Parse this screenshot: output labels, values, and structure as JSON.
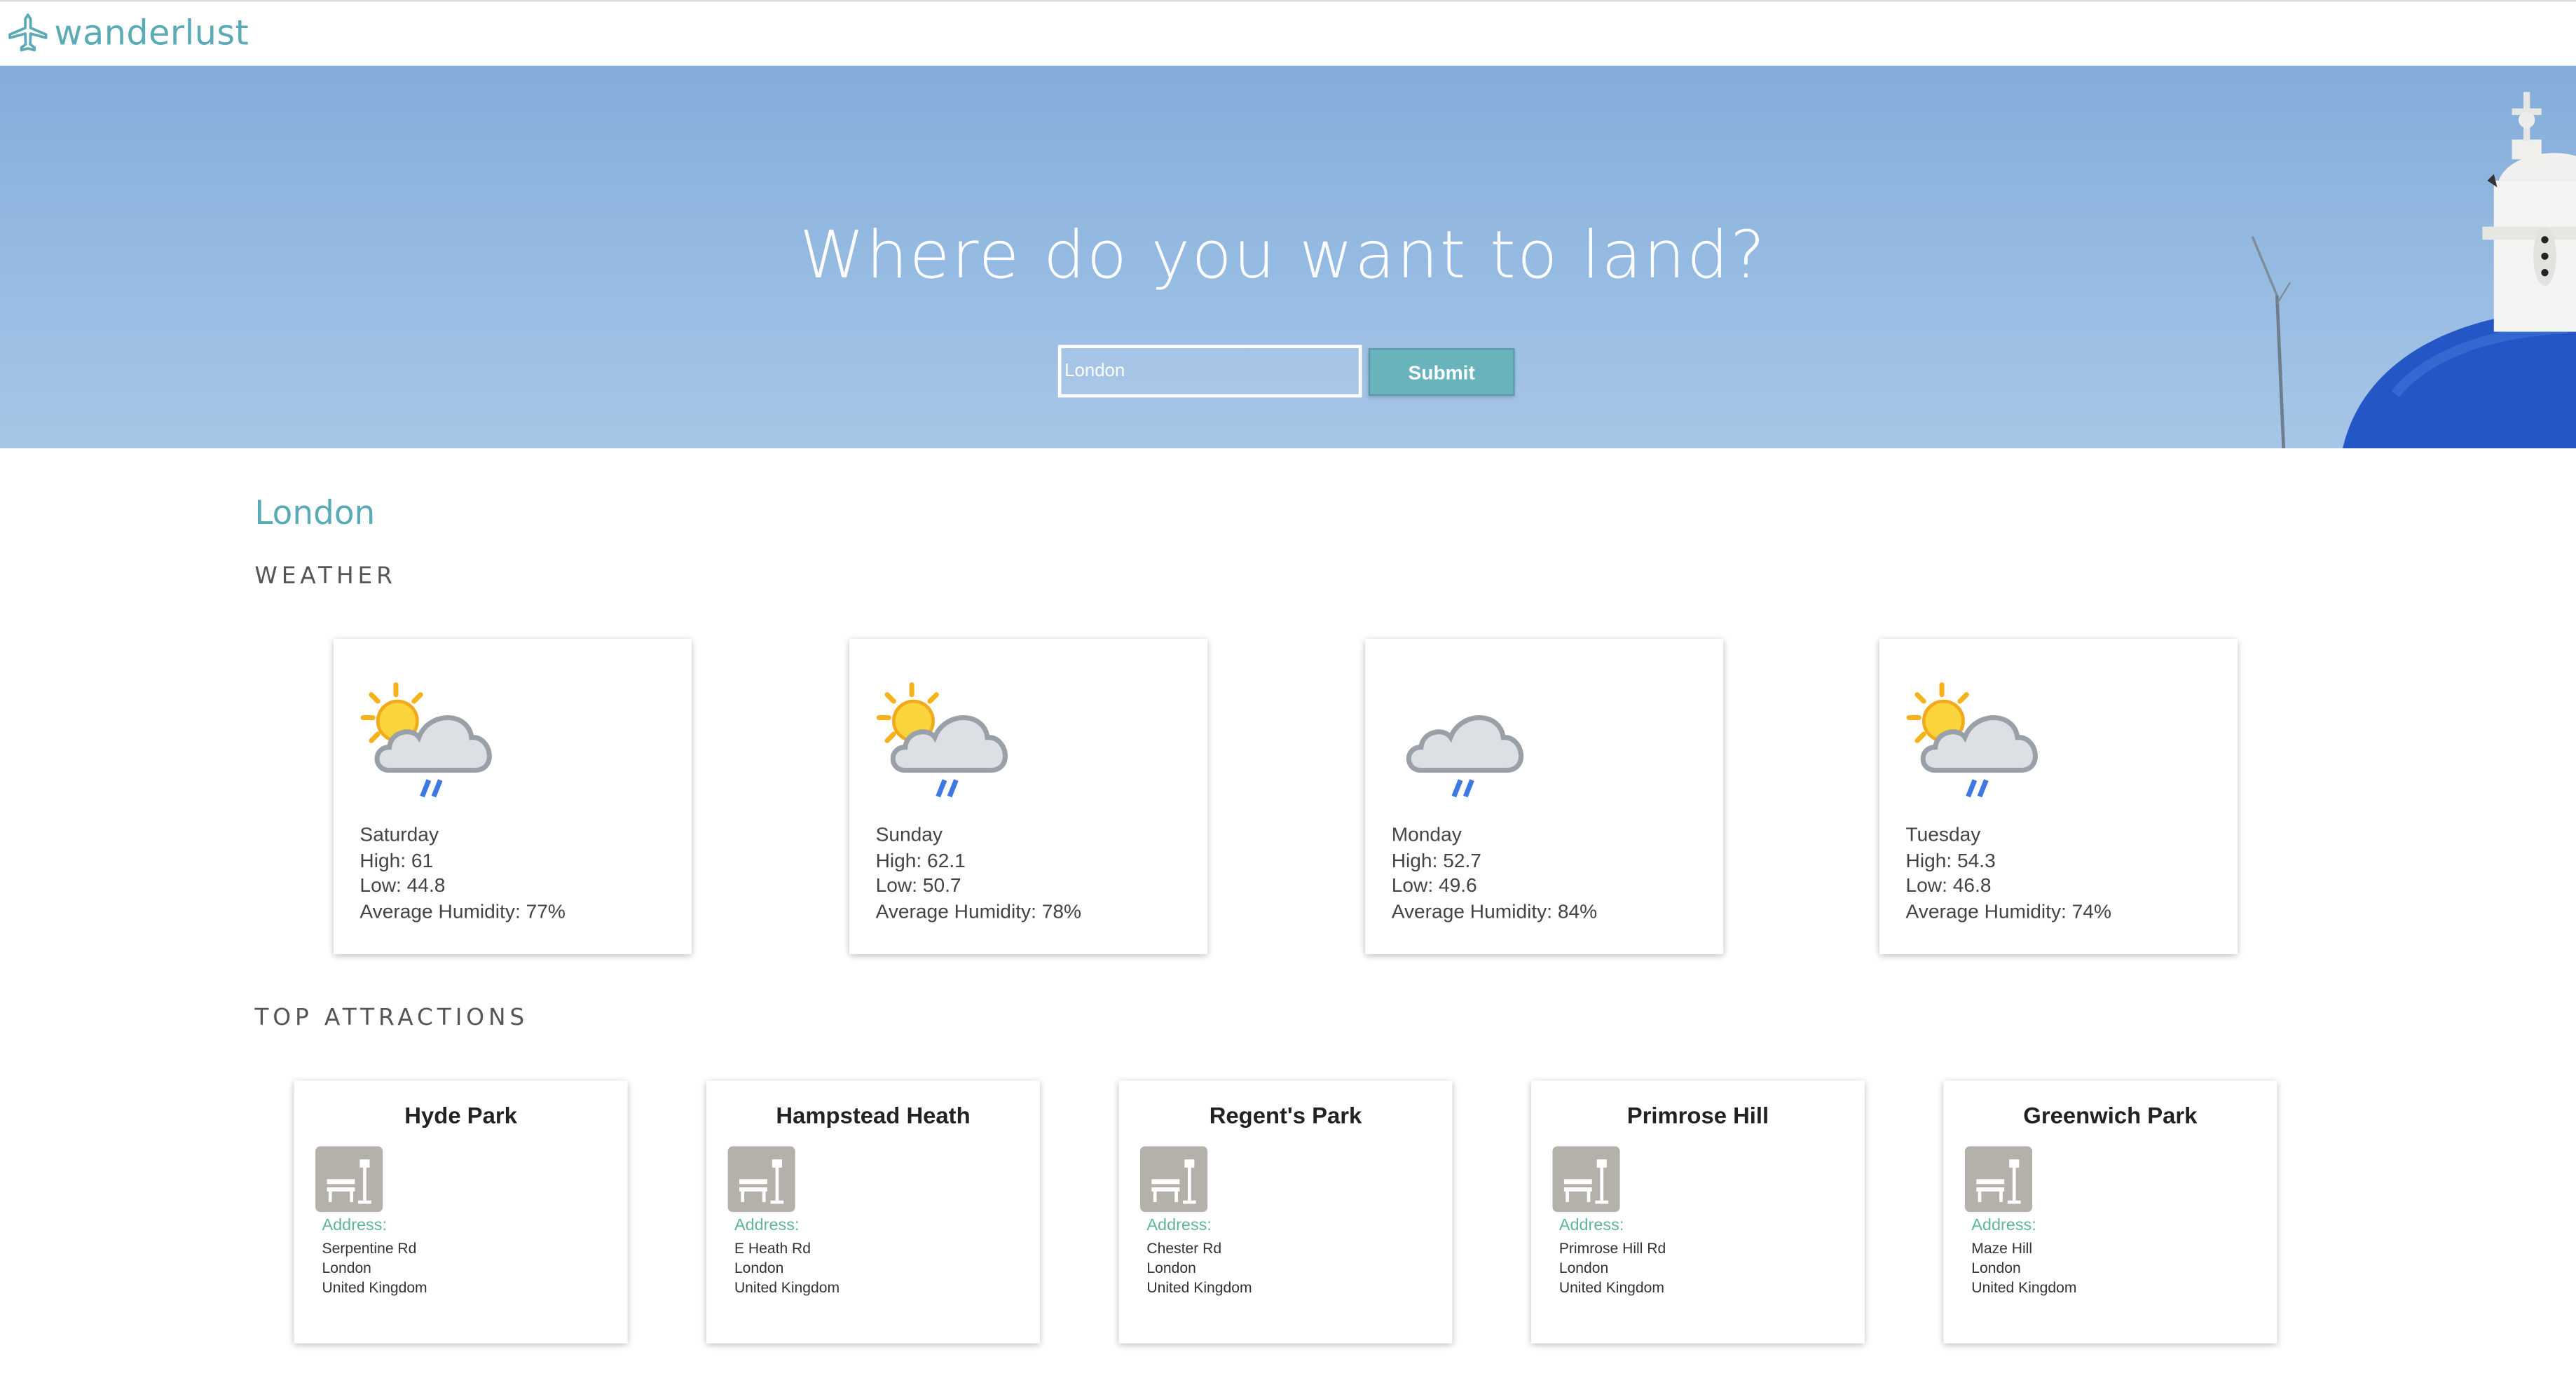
{
  "nav": {
    "brand": "wanderlust"
  },
  "hero": {
    "title": "Where do you want to land?",
    "search_value": "London",
    "search_placeholder": "London",
    "submit_label": "Submit"
  },
  "city": "London",
  "sections": {
    "weather": "WEATHER",
    "attractions": "TOP ATTRACTIONS"
  },
  "weather": [
    {
      "day": "Saturday",
      "high": "High: 61",
      "low": "Low: 44.8",
      "humidity": "Average Humidity: 77%",
      "icon": "sun-cloud-rain-icon"
    },
    {
      "day": "Sunday",
      "high": "High: 62.1",
      "low": "Low: 50.7",
      "humidity": "Average Humidity: 78%",
      "icon": "sun-cloud-rain-icon"
    },
    {
      "day": "Monday",
      "high": "High: 52.7",
      "low": "Low: 49.6",
      "humidity": "Average Humidity: 84%",
      "icon": "cloud-rain-icon"
    },
    {
      "day": "Tuesday",
      "high": "High: 54.3",
      "low": "Low: 46.8",
      "humidity": "Average Humidity: 74%",
      "icon": "sun-cloud-rain-icon"
    }
  ],
  "attractions": [
    {
      "name": "Hyde Park",
      "address_label": "Address:",
      "line1": "Serpentine Rd",
      "line2": "London",
      "line3": "United Kingdom"
    },
    {
      "name": "Hampstead Heath",
      "address_label": "Address:",
      "line1": "E Heath Rd",
      "line2": "London",
      "line3": "United Kingdom"
    },
    {
      "name": "Regent's Park",
      "address_label": "Address:",
      "line1": "Chester Rd",
      "line2": "London",
      "line3": "United Kingdom"
    },
    {
      "name": "Primrose Hill",
      "address_label": "Address:",
      "line1": "Primrose Hill Rd",
      "line2": "London",
      "line3": "United Kingdom"
    },
    {
      "name": "Greenwich Park",
      "address_label": "Address:",
      "line1": "Maze Hill",
      "line2": "London",
      "line3": "United Kingdom"
    }
  ],
  "colors": {
    "accent": "#5aabb5",
    "button": "#69b3bd",
    "address_label": "#5fb596",
    "dome_blue": "#2457c5"
  }
}
